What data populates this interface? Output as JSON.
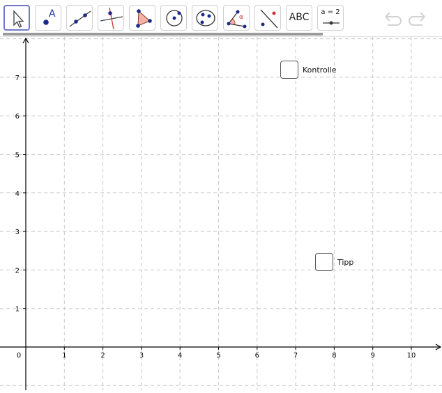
{
  "toolbar": {
    "tools": [
      {
        "id": "move",
        "icon": "arrow-cursor-icon"
      },
      {
        "id": "point",
        "icon": "point-icon",
        "text": "A"
      },
      {
        "id": "line",
        "icon": "line-icon"
      },
      {
        "id": "perpendicular",
        "icon": "perpendicular-line-icon"
      },
      {
        "id": "polygon",
        "icon": "polygon-icon"
      },
      {
        "id": "circle",
        "icon": "circle-icon"
      },
      {
        "id": "conic",
        "icon": "conic-icon"
      },
      {
        "id": "angle",
        "icon": "angle-icon",
        "text": "α"
      },
      {
        "id": "reflect",
        "icon": "reflect-icon"
      },
      {
        "id": "text",
        "icon": "text-icon",
        "text": "ABC"
      },
      {
        "id": "slider",
        "icon": "slider-icon",
        "text": "a = 2"
      }
    ],
    "active_tool": "move",
    "undo_icon": "undo-icon",
    "redo_icon": "redo-icon"
  },
  "graphics": {
    "x_ticks": [
      "0",
      "1",
      "2",
      "3",
      "4",
      "5",
      "6",
      "7",
      "8",
      "9",
      "10"
    ],
    "y_ticks": [
      "1",
      "2",
      "3",
      "4",
      "5",
      "6",
      "7"
    ],
    "grid": true,
    "grid_style": "dashed",
    "axis_color": "#000000",
    "grid_color": "#c8c8c8"
  },
  "checkboxes": {
    "kontrolle": {
      "label": "Kontrolle",
      "checked": false
    },
    "tipp": {
      "label": "Tipp",
      "checked": false
    }
  }
}
